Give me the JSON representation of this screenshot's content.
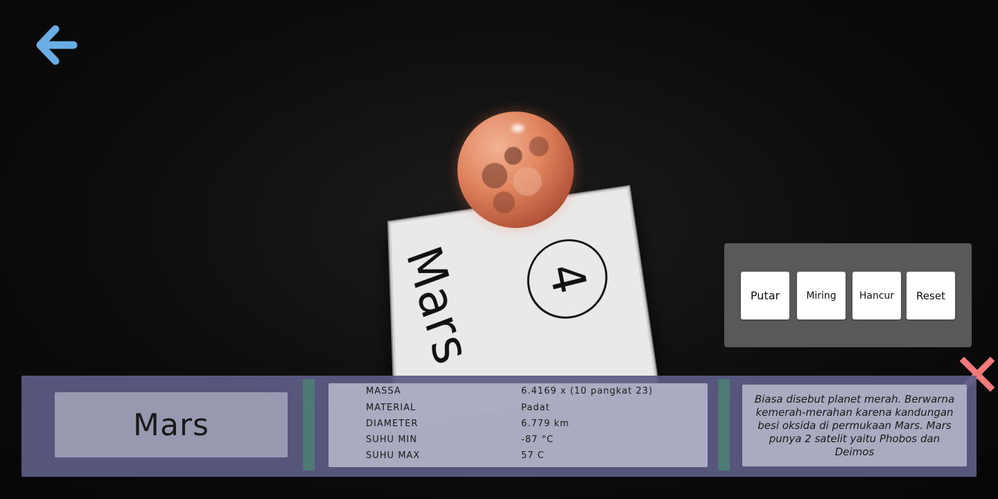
{
  "card": {
    "title": "Mars",
    "number": "4"
  },
  "controls": {
    "putar": "Putar",
    "miring": "Miring",
    "hancur": "Hancur",
    "reset": "Reset"
  },
  "info": {
    "name": "Mars",
    "stats": [
      {
        "label": "MASSA",
        "value": "6.4169 x (10 pangkat 23)"
      },
      {
        "label": "MATERIAL",
        "value": "Padat"
      },
      {
        "label": "DIAMETER",
        "value": "6.779 km"
      },
      {
        "label": "SUHU MIN",
        "value": "-87 °C"
      },
      {
        "label": "SUHU MAX",
        "value": "57 C"
      }
    ],
    "description": "Biasa disebut planet merah. Berwarna kemerah-merahan karena kandungan besi oksida di permukaan Mars. Mars punya 2 satelit yaitu Phobos dan Deimos"
  },
  "icons": {
    "back": "arrow-left-icon",
    "close": "close-x-icon"
  },
  "colors": {
    "back_arrow": "#6aaee6",
    "close_x": "#f07a7a",
    "info_panel": "#5c5c86",
    "divider": "#4e7a76",
    "controls_panel": "#595959"
  }
}
